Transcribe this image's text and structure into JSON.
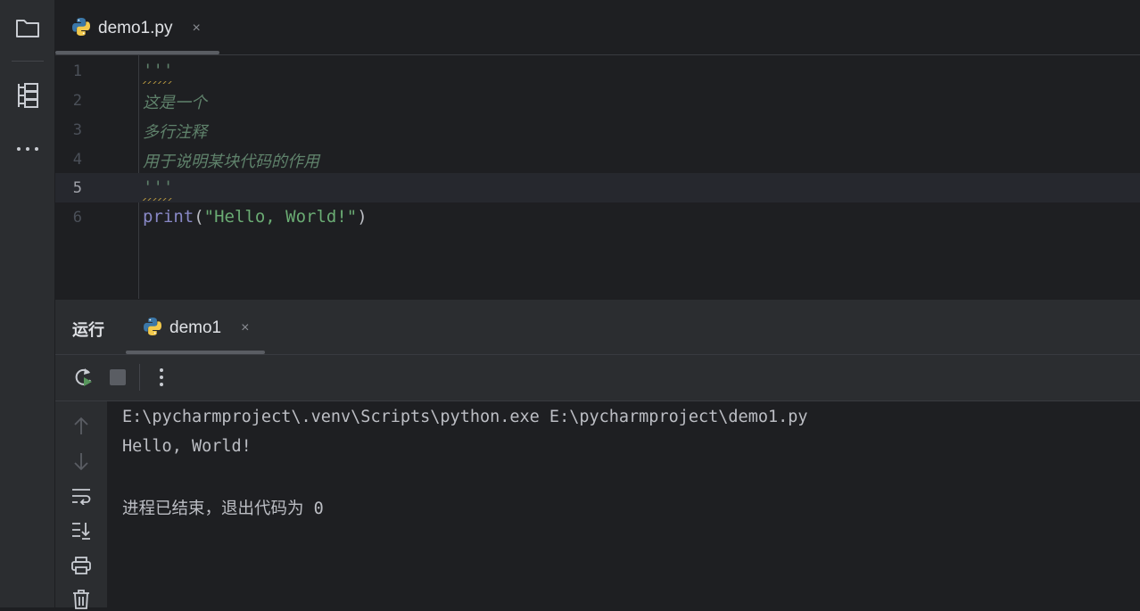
{
  "toolstrip": {
    "icons": [
      "folder-icon",
      "structure-icon",
      "more-icon"
    ]
  },
  "editor": {
    "tab_label": "demo1.py",
    "tab_close": "×",
    "lines": [
      {
        "num": "1",
        "text": "'''"
      },
      {
        "num": "2",
        "text": "这是一个"
      },
      {
        "num": "3",
        "text": "多行注释"
      },
      {
        "num": "4",
        "text": "用于说明某块代码的作用"
      },
      {
        "num": "5",
        "text": "'''"
      },
      {
        "num": "6",
        "fn": "print",
        "open": "(",
        "str": "\"Hello, World!\"",
        "close": ")"
      }
    ]
  },
  "run": {
    "title": "运行",
    "tab_label": "demo1",
    "tab_close": "×",
    "console": [
      "E:\\pycharmproject\\.venv\\Scripts\\python.exe E:\\pycharmproject\\demo1.py",
      "Hello, World!",
      "",
      "进程已结束，退出代码为 0"
    ]
  },
  "colors": {
    "comment": "#5f826b",
    "string": "#6aab73",
    "builtin": "#8888c6",
    "background": "#1e1f22",
    "panel": "#2b2d30"
  }
}
